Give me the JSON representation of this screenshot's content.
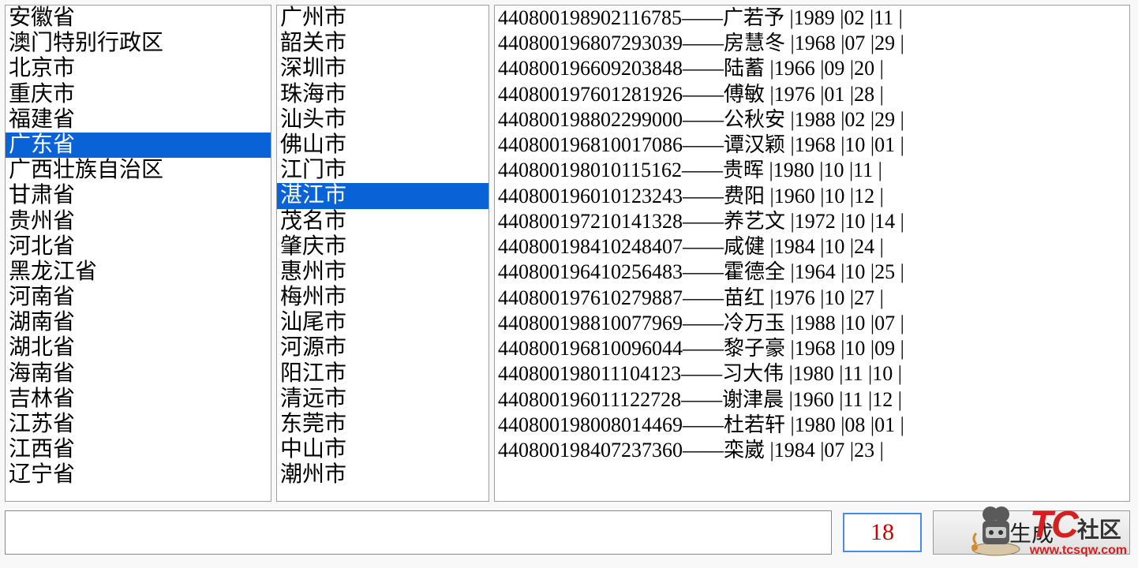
{
  "provinces": {
    "selected_index": 5,
    "items": [
      "安徽省",
      "澳门特别行政区",
      "北京市",
      "重庆市",
      "福建省",
      "广东省",
      "广西壮族自治区",
      "甘肃省",
      "贵州省",
      "河北省",
      "黑龙江省",
      "河南省",
      "湖南省",
      "湖北省",
      "海南省",
      "吉林省",
      "江苏省",
      "江西省",
      "辽宁省"
    ]
  },
  "cities": {
    "selected_index": 7,
    "items": [
      "广州市",
      "韶关市",
      "深圳市",
      "珠海市",
      "汕头市",
      "佛山市",
      "江门市",
      "湛江市",
      "茂名市",
      "肇庆市",
      "惠州市",
      "梅州市",
      "汕尾市",
      "河源市",
      "阳江市",
      "清远市",
      "东莞市",
      "中山市",
      "潮州市"
    ]
  },
  "results": [
    {
      "id": "440800198902116785",
      "name": "广若予",
      "year": "1989",
      "month": "02",
      "day": "11"
    },
    {
      "id": "440800196807293039",
      "name": "房慧冬",
      "year": "1968",
      "month": "07",
      "day": "29"
    },
    {
      "id": "440800196609203848",
      "name": "陆蓄",
      "year": "1966",
      "month": "09",
      "day": "20"
    },
    {
      "id": "440800197601281926",
      "name": "傅敏",
      "year": "1976",
      "month": "01",
      "day": "28"
    },
    {
      "id": "440800198802299000",
      "name": "公秋安",
      "year": "1988",
      "month": "02",
      "day": "29"
    },
    {
      "id": "440800196810017086",
      "name": "谭汉颖",
      "year": "1968",
      "month": "10",
      "day": "01"
    },
    {
      "id": "440800198010115162",
      "name": "贵晖",
      "year": "1980",
      "month": "10",
      "day": "11"
    },
    {
      "id": "440800196010123243",
      "name": "费阳",
      "year": "1960",
      "month": "10",
      "day": "12"
    },
    {
      "id": "440800197210141328",
      "name": "养艺文",
      "year": "1972",
      "month": "10",
      "day": "14"
    },
    {
      "id": "440800198410248407",
      "name": "咸健",
      "year": "1984",
      "month": "10",
      "day": "24"
    },
    {
      "id": "440800196410256483",
      "name": "霍德全",
      "year": "1964",
      "month": "10",
      "day": "25"
    },
    {
      "id": "440800197610279887",
      "name": "苗红",
      "year": "1976",
      "month": "10",
      "day": "27"
    },
    {
      "id": "440800198810077969",
      "name": "冷万玉",
      "year": "1988",
      "month": "10",
      "day": "07"
    },
    {
      "id": "440800196810096044",
      "name": "黎子豪",
      "year": "1968",
      "month": "10",
      "day": "09"
    },
    {
      "id": "440800198011104123",
      "name": "习大伟",
      "year": "1980",
      "month": "11",
      "day": "10"
    },
    {
      "id": "440800196011122728",
      "name": "谢津晨",
      "year": "1960",
      "month": "11",
      "day": "12"
    },
    {
      "id": "440800198008014469",
      "name": "杜若轩",
      "year": "1980",
      "month": "08",
      "day": "01"
    },
    {
      "id": "440800198407237360",
      "name": "栾崴",
      "year": "1984",
      "month": "07",
      "day": "23"
    }
  ],
  "bottom": {
    "text_value": "",
    "count_value": "18",
    "generate_label": "生成"
  },
  "watermark": {
    "tc": "TC",
    "sq": "社区",
    "url": "www.tcsqw.com"
  }
}
